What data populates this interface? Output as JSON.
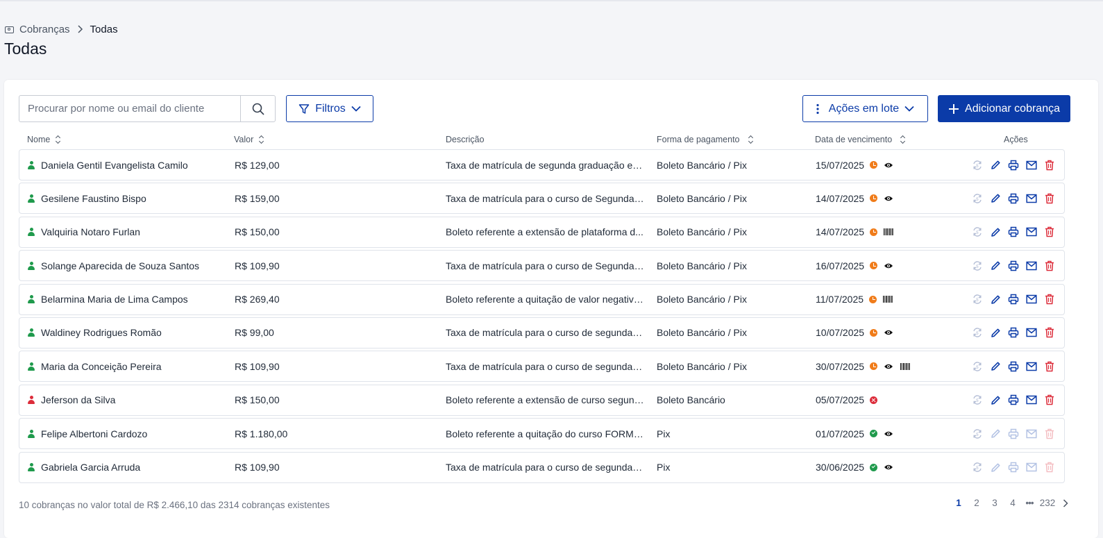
{
  "breadcrumb": {
    "root": "Cobranças",
    "current": "Todas"
  },
  "page_title": "Todas",
  "toolbar": {
    "search_placeholder": "Procurar por nome ou email do cliente",
    "filters_label": "Filtros",
    "batch_label": "Ações em lote",
    "add_label": "Adicionar cobrança"
  },
  "columns": {
    "nome": "Nome",
    "valor": "Valor",
    "descricao": "Descrição",
    "forma": "Forma de pagamento",
    "data": "Data de vencimento",
    "acoes": "Ações"
  },
  "rows": [
    {
      "name": "Daniela Gentil Evangelista Camilo",
      "person_status": "active",
      "valor": "R$ 129,00",
      "descricao": "Taxa de matrícula de segunda graduação em...",
      "forma": "Boleto Bancário / Pix",
      "data": "15/07/2025",
      "status": "pending",
      "view": true,
      "barcode": false,
      "actions_disabled": false
    },
    {
      "name": "Gesilene Faustino Bispo",
      "person_status": "active",
      "valor": "R$ 159,00",
      "descricao": "Taxa de matrícula para o curso de Segunda ...",
      "forma": "Boleto Bancário / Pix",
      "data": "14/07/2025",
      "status": "pending",
      "view": true,
      "barcode": false,
      "actions_disabled": false
    },
    {
      "name": "Valquiria Notaro Furlan",
      "person_status": "active",
      "valor": "R$ 150,00",
      "descricao": "Boleto referente a extensão de plataforma d...",
      "forma": "Boleto Bancário / Pix",
      "data": "14/07/2025",
      "status": "pending",
      "view": false,
      "barcode": true,
      "actions_disabled": false
    },
    {
      "name": "Solange Aparecida de Souza Santos",
      "person_status": "active",
      "valor": "R$ 109,90",
      "descricao": "Taxa de matrícula para o curso de Segunda ...",
      "forma": "Boleto Bancário / Pix",
      "data": "16/07/2025",
      "status": "pending",
      "view": true,
      "barcode": false,
      "actions_disabled": false
    },
    {
      "name": "Belarmina Maria de Lima Campos",
      "person_status": "active",
      "valor": "R$ 269,40",
      "descricao": "Boleto referente a quitação de valor negativa...",
      "forma": "Boleto Bancário / Pix",
      "data": "11/07/2025",
      "status": "pending",
      "view": false,
      "barcode": true,
      "actions_disabled": false
    },
    {
      "name": "Waldiney Rodrigues Romão",
      "person_status": "active",
      "valor": "R$ 99,00",
      "descricao": "Taxa de matrícula para o curso de segunda li...",
      "forma": "Boleto Bancário / Pix",
      "data": "10/07/2025",
      "status": "pending",
      "view": true,
      "barcode": false,
      "actions_disabled": false
    },
    {
      "name": "Maria da Conceição Pereira",
      "person_status": "active",
      "valor": "R$ 109,90",
      "descricao": "Taxa de matrícula para o curso de segunda li...",
      "forma": "Boleto Bancário / Pix",
      "data": "30/07/2025",
      "status": "pending",
      "view": true,
      "barcode": true,
      "actions_disabled": false
    },
    {
      "name": "Jeferson da Silva",
      "person_status": "inactive",
      "valor": "R$ 150,00",
      "descricao": "Boleto referente a extensão de curso segund...",
      "forma": "Boleto Bancário",
      "data": "05/07/2025",
      "status": "overdue",
      "view": false,
      "barcode": false,
      "actions_disabled": false
    },
    {
      "name": "Felipe Albertoni Cardozo",
      "person_status": "active",
      "valor": "R$ 1.180,00",
      "descricao": "Boleto referente a quitação do curso FORMA...",
      "forma": "Pix",
      "data": "01/07/2025",
      "status": "paid",
      "view": true,
      "barcode": false,
      "actions_disabled": true
    },
    {
      "name": "Gabriela Garcia Arruda",
      "person_status": "active",
      "valor": "R$ 109,90",
      "descricao": "Taxa de matrícula para o curso de segunda li...",
      "forma": "Pix",
      "data": "30/06/2025",
      "status": "paid",
      "view": true,
      "barcode": false,
      "actions_disabled": true
    }
  ],
  "footer": {
    "summary": "10 cobranças no valor total de R$ 2.466,10 das 2314 cobranças existentes"
  },
  "pagination": {
    "pages": [
      "1",
      "2",
      "3",
      "4"
    ],
    "active": "1",
    "ellipsis": "•••",
    "last": "232"
  },
  "colors": {
    "brand": "#0b3ba8",
    "person_active": "#1f9a4c",
    "person_inactive": "#dc2c3a",
    "status_pending": "#f07c1a",
    "status_overdue": "#dc2c3a",
    "status_paid": "#1f9a4c",
    "edit": "#0b3ba8",
    "delete": "#dc2c3a",
    "resend": "#9aa7c7"
  },
  "icons": {
    "row_actions": [
      "resend-icon",
      "edit-icon",
      "print-icon",
      "email-icon",
      "delete-icon"
    ]
  }
}
